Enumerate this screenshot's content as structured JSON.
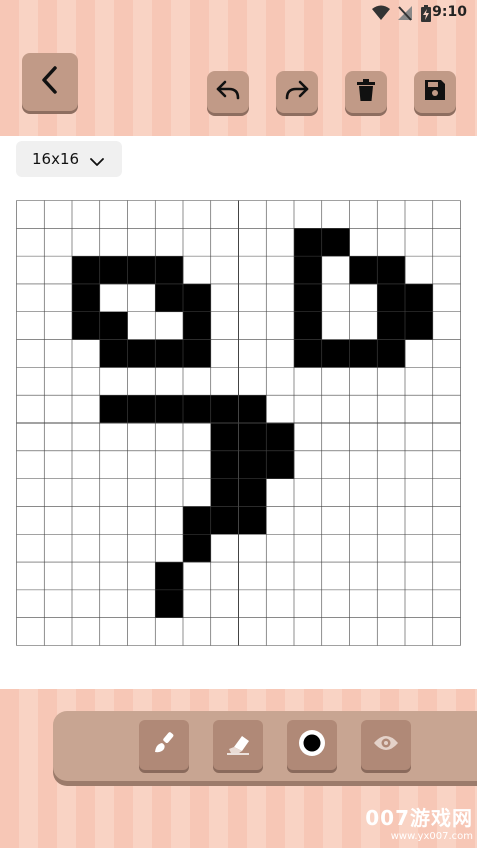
{
  "status_bar": {
    "time": "9:10",
    "icons": [
      "wifi-icon",
      "no-signal-icon",
      "battery-charging-icon"
    ]
  },
  "toolbar": {
    "back_icon": "chevron-left-icon",
    "undo_icon": "undo-icon",
    "redo_icon": "redo-icon",
    "delete_icon": "trash-icon",
    "save_icon": "floppy-disk-icon"
  },
  "size_select": {
    "value": "16x16"
  },
  "canvas": {
    "columns": 16,
    "rows": 16,
    "filled_color": "#000000",
    "grid_color": "#444444",
    "filled_cells": [
      [
        1,
        10
      ],
      [
        1,
        11
      ],
      [
        2,
        2
      ],
      [
        2,
        3
      ],
      [
        2,
        4
      ],
      [
        2,
        5
      ],
      [
        2,
        10
      ],
      [
        2,
        12
      ],
      [
        2,
        13
      ],
      [
        3,
        2
      ],
      [
        3,
        5
      ],
      [
        3,
        6
      ],
      [
        3,
        10
      ],
      [
        3,
        13
      ],
      [
        3,
        14
      ],
      [
        4,
        2
      ],
      [
        4,
        3
      ],
      [
        4,
        6
      ],
      [
        4,
        10
      ],
      [
        4,
        13
      ],
      [
        4,
        14
      ],
      [
        5,
        3
      ],
      [
        5,
        4
      ],
      [
        5,
        5
      ],
      [
        5,
        6
      ],
      [
        5,
        10
      ],
      [
        5,
        11
      ],
      [
        5,
        12
      ],
      [
        5,
        13
      ],
      [
        7,
        3
      ],
      [
        7,
        4
      ],
      [
        7,
        5
      ],
      [
        7,
        6
      ],
      [
        7,
        7
      ],
      [
        7,
        8
      ],
      [
        8,
        7
      ],
      [
        8,
        8
      ],
      [
        8,
        9
      ],
      [
        9,
        7
      ],
      [
        9,
        8
      ],
      [
        9,
        9
      ],
      [
        10,
        7
      ],
      [
        10,
        8
      ],
      [
        11,
        6
      ],
      [
        11,
        7
      ],
      [
        11,
        8
      ],
      [
        12,
        6
      ],
      [
        13,
        5
      ],
      [
        14,
        5
      ]
    ]
  },
  "bottom_toolbar": {
    "brush_icon": "brush-icon",
    "eraser_icon": "eraser-icon",
    "color_icon": "color-dot-icon",
    "preview_icon": "eye-icon"
  },
  "colors": {
    "header_stripe_a": "#f7c7b6",
    "header_stripe_b": "#f9d3c4",
    "button": "#c19a87",
    "toolbar_panel": "#c8a592"
  },
  "watermark": {
    "main": "007游戏网",
    "url": "www.yx007.com"
  }
}
